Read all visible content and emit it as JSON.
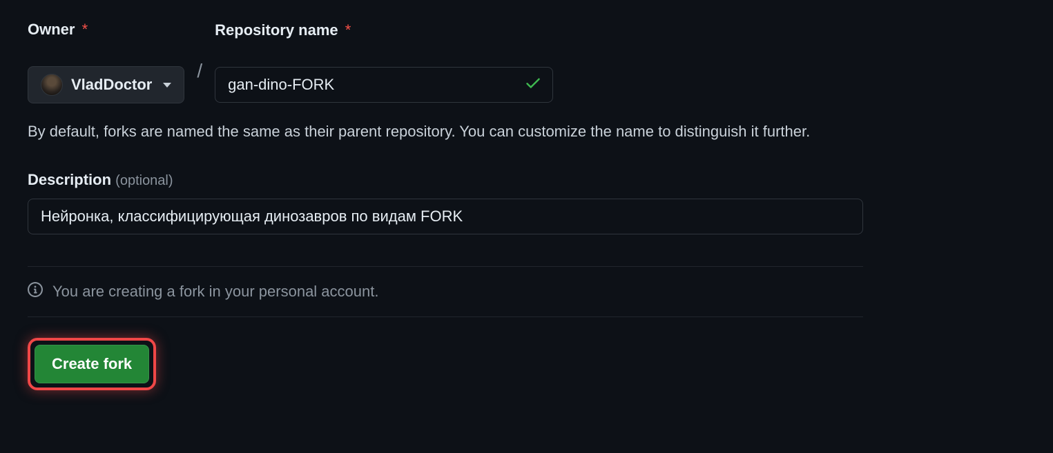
{
  "owner": {
    "label": "Owner",
    "name": "VladDoctor"
  },
  "repo": {
    "label": "Repository name",
    "value": "gan-dino-FORK",
    "valid": true
  },
  "helper": "By default, forks are named the same as their parent repository. You can customize the name to distinguish it further.",
  "description": {
    "label": "Description",
    "optional": "(optional)",
    "value": "Нейронка, классифицирующая динозавров по видам FORK"
  },
  "info": "You are creating a fork in your personal account.",
  "create_label": "Create fork",
  "required_mark": "*",
  "slash": "/"
}
